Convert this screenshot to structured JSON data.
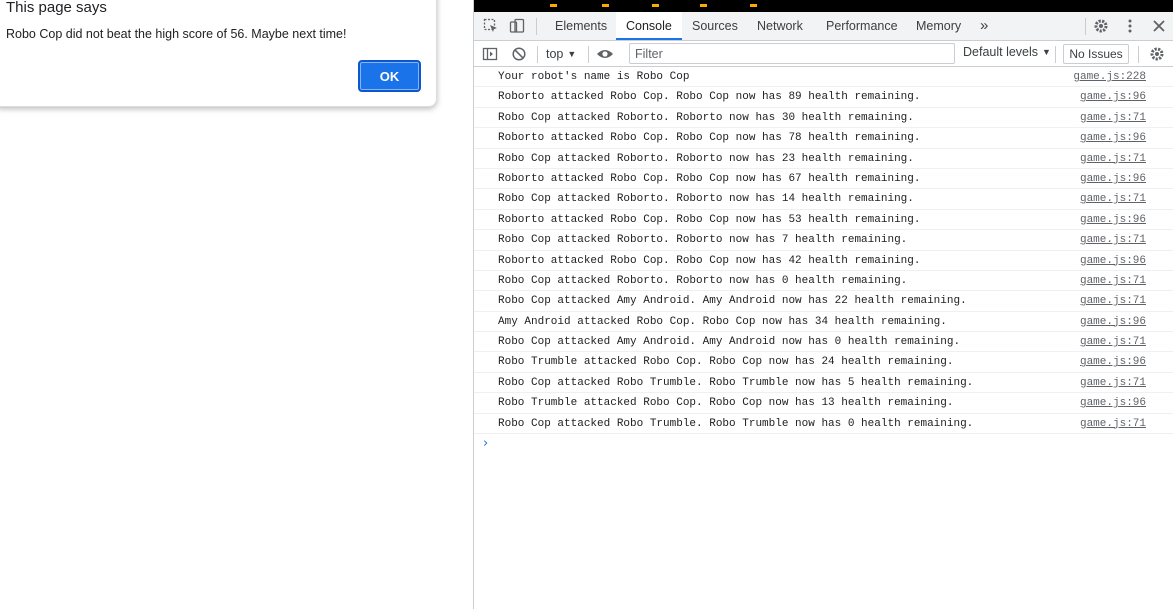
{
  "dialog": {
    "title": "This page says",
    "message": "Robo Cop did not beat the high score of 56. Maybe next time!",
    "ok_label": "OK"
  },
  "devtools": {
    "tabs": [
      {
        "label": "Elements",
        "active": false
      },
      {
        "label": "Console",
        "active": true
      },
      {
        "label": "Sources",
        "active": false
      },
      {
        "label": "Network",
        "active": false
      },
      {
        "label": "Performance",
        "active": false
      },
      {
        "label": "Memory",
        "active": false
      }
    ],
    "more_tabs_glyph": "»",
    "toolbar": {
      "context": "top",
      "filter_placeholder": "Filter",
      "levels": "Default levels",
      "issues": "No Issues"
    },
    "logs": [
      {
        "msg": "Your robot's name is Robo Cop",
        "src": "game.js:228"
      },
      {
        "msg": "Roborto attacked Robo Cop. Robo Cop now has 89 health remaining.",
        "src": "game.js:96"
      },
      {
        "msg": "Robo Cop attacked Roborto. Roborto now has 30 health remaining.",
        "src": "game.js:71"
      },
      {
        "msg": "Roborto attacked Robo Cop. Robo Cop now has 78 health remaining.",
        "src": "game.js:96"
      },
      {
        "msg": "Robo Cop attacked Roborto. Roborto now has 23 health remaining.",
        "src": "game.js:71"
      },
      {
        "msg": "Roborto attacked Robo Cop. Robo Cop now has 67 health remaining.",
        "src": "game.js:96"
      },
      {
        "msg": "Robo Cop attacked Roborto. Roborto now has 14 health remaining.",
        "src": "game.js:71"
      },
      {
        "msg": "Roborto attacked Robo Cop. Robo Cop now has 53 health remaining.",
        "src": "game.js:96"
      },
      {
        "msg": "Robo Cop attacked Roborto. Roborto now has 7 health remaining.",
        "src": "game.js:71"
      },
      {
        "msg": "Roborto attacked Robo Cop. Robo Cop now has 42 health remaining.",
        "src": "game.js:96"
      },
      {
        "msg": "Robo Cop attacked Roborto. Roborto now has 0 health remaining.",
        "src": "game.js:71"
      },
      {
        "msg": "Robo Cop attacked Amy Android. Amy Android now has 22 health remaining.",
        "src": "game.js:71"
      },
      {
        "msg": "Amy Android attacked Robo Cop. Robo Cop now has 34 health remaining.",
        "src": "game.js:96"
      },
      {
        "msg": "Robo Cop attacked Amy Android. Amy Android now has 0 health remaining.",
        "src": "game.js:71"
      },
      {
        "msg": "Robo Trumble attacked Robo Cop. Robo Cop now has 24 health remaining.",
        "src": "game.js:96"
      },
      {
        "msg": "Robo Cop attacked Robo Trumble. Robo Trumble now has 5 health remaining.",
        "src": "game.js:71"
      },
      {
        "msg": "Robo Trumble attacked Robo Cop. Robo Cop now has 13 health remaining.",
        "src": "game.js:96"
      },
      {
        "msg": "Robo Cop attacked Robo Trumble. Robo Trumble now has 0 health remaining.",
        "src": "game.js:71"
      }
    ]
  }
}
